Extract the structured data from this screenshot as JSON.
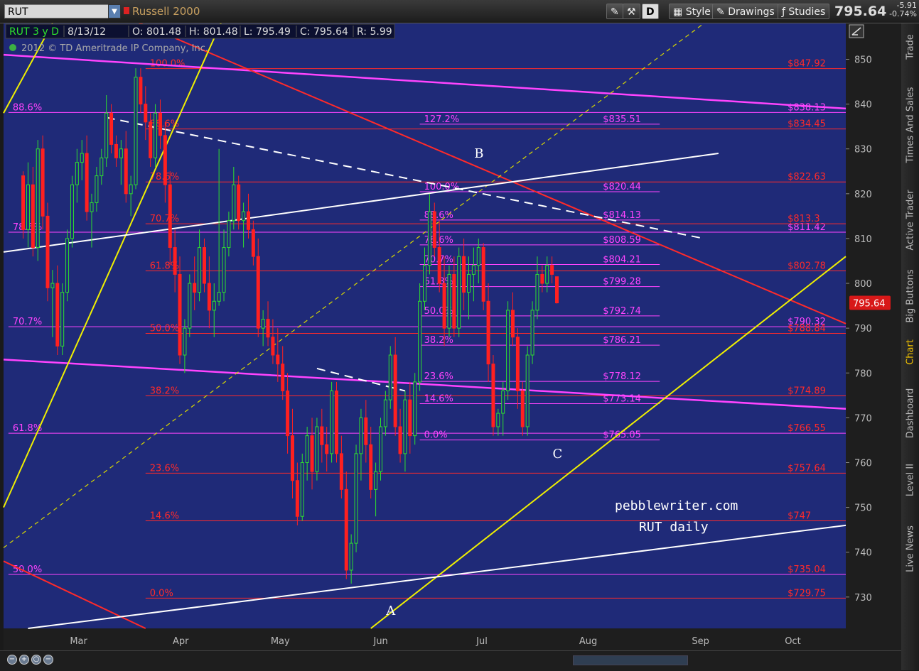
{
  "toolbar": {
    "symbol": "RUT",
    "symbol_name": "Russell 2000",
    "d_label": "D",
    "style_label": "Style",
    "drawings_label": "Drawings",
    "studies_label": "Studies",
    "last_price": "795.64",
    "change": "-5.91",
    "change_pct": "-0.74%"
  },
  "sidebar": {
    "tabs": [
      "Trade",
      "Times And Sales",
      "Active Trader",
      "Big Buttons",
      "Chart",
      "Dashboard",
      "Level II",
      "Live News"
    ],
    "active": "Chart"
  },
  "chart_data": {
    "type": "candlestick",
    "info_bar": {
      "title": "RUT 3 y D",
      "date": "8/13/12",
      "open": "O: 801.48",
      "high": "H: 801.48",
      "low": "L: 795.49",
      "close": "C: 795.64",
      "range": "R: 5.99"
    },
    "copyright": "2012 © TD Ameritrade IP Company, Inc.",
    "ylim": [
      723,
      858
    ],
    "y_ticks": [
      730,
      740,
      750,
      760,
      770,
      780,
      790,
      800,
      810,
      820,
      830,
      840,
      850
    ],
    "x_ticks": [
      {
        "label": "Mar",
        "x": 0
      },
      {
        "label": "Apr",
        "x": 21
      },
      {
        "label": "May",
        "x": 41
      },
      {
        "label": "Jun",
        "x": 62
      },
      {
        "label": "Jul",
        "x": 83
      },
      {
        "label": "Aug",
        "x": 104
      },
      {
        "label": "Sep",
        "x": 127
      },
      {
        "label": "Oct",
        "x": 146
      }
    ],
    "xlim": [
      -15,
      157
    ],
    "last_price_label": "795.64",
    "candles": [
      [
        -11,
        824,
        825,
        810,
        812
      ],
      [
        -10,
        812,
        827,
        808,
        822
      ],
      [
        -9,
        822,
        826,
        806,
        808
      ],
      [
        -8,
        808,
        832,
        805,
        830
      ],
      [
        -7,
        830,
        833,
        812,
        815
      ],
      [
        -6,
        815,
        818,
        796,
        799
      ],
      [
        -5,
        799,
        803,
        788,
        800
      ],
      [
        -4,
        800,
        804,
        784,
        786
      ],
      [
        -3,
        786,
        800,
        784,
        798
      ],
      [
        -2,
        798,
        812,
        796,
        810
      ],
      [
        -1,
        810,
        824,
        808,
        822
      ],
      [
        0,
        822,
        830,
        818,
        827
      ],
      [
        1,
        827,
        832,
        823,
        829
      ],
      [
        2,
        829,
        833,
        814,
        816
      ],
      [
        3,
        816,
        820,
        808,
        818
      ],
      [
        4,
        818,
        826,
        816,
        824
      ],
      [
        5,
        824,
        830,
        822,
        828
      ],
      [
        6,
        828,
        842,
        826,
        838
      ],
      [
        7,
        838,
        840,
        829,
        831
      ],
      [
        8,
        831,
        833,
        826,
        828
      ],
      [
        9,
        828,
        832,
        822,
        830
      ],
      [
        10,
        830,
        834,
        818,
        820
      ],
      [
        11,
        820,
        824,
        815,
        822
      ],
      [
        12,
        822,
        848,
        821,
        846
      ],
      [
        13,
        846,
        848,
        838,
        840
      ],
      [
        14,
        840,
        844,
        832,
        836
      ],
      [
        15,
        836,
        838,
        826,
        828
      ],
      [
        16,
        828,
        840,
        826,
        838
      ],
      [
        17,
        838,
        841,
        830,
        833
      ],
      [
        18,
        833,
        836,
        818,
        822
      ],
      [
        19,
        822,
        825,
        804,
        808
      ],
      [
        20,
        808,
        812,
        798,
        802
      ],
      [
        21,
        802,
        806,
        782,
        784
      ],
      [
        22,
        784,
        792,
        780,
        790
      ],
      [
        23,
        790,
        802,
        788,
        800
      ],
      [
        24,
        800,
        806,
        794,
        798
      ],
      [
        25,
        798,
        812,
        796,
        808
      ],
      [
        26,
        808,
        810,
        798,
        800
      ],
      [
        27,
        800,
        806,
        790,
        794
      ],
      [
        28,
        794,
        800,
        788,
        796
      ],
      [
        29,
        796,
        830,
        795,
        798
      ],
      [
        30,
        798,
        812,
        796,
        808
      ],
      [
        31,
        808,
        816,
        806,
        814
      ],
      [
        32,
        814,
        826,
        812,
        822
      ],
      [
        33,
        822,
        824,
        812,
        814
      ],
      [
        34,
        814,
        818,
        808,
        816
      ],
      [
        35,
        816,
        820,
        810,
        812
      ],
      [
        36,
        812,
        814,
        804,
        806
      ],
      [
        37,
        806,
        810,
        788,
        790
      ],
      [
        38,
        790,
        794,
        786,
        792
      ],
      [
        39,
        792,
        796,
        786,
        788
      ],
      [
        40,
        788,
        792,
        782,
        784
      ],
      [
        41,
        784,
        790,
        778,
        782
      ],
      [
        42,
        782,
        786,
        774,
        776
      ],
      [
        43,
        776,
        780,
        762,
        766
      ],
      [
        44,
        766,
        772,
        752,
        756
      ],
      [
        45,
        756,
        760,
        746,
        748
      ],
      [
        46,
        748,
        762,
        747,
        760
      ],
      [
        47,
        760,
        768,
        756,
        766
      ],
      [
        48,
        766,
        770,
        754,
        758
      ],
      [
        49,
        758,
        770,
        756,
        768
      ],
      [
        50,
        768,
        772,
        760,
        764
      ],
      [
        51,
        764,
        768,
        758,
        762
      ],
      [
        52,
        762,
        778,
        760,
        776
      ],
      [
        53,
        776,
        778,
        760,
        762
      ],
      [
        54,
        762,
        766,
        752,
        754
      ],
      [
        55,
        754,
        758,
        734,
        736
      ],
      [
        56,
        736,
        744,
        733,
        742
      ],
      [
        57,
        742,
        764,
        740,
        762
      ],
      [
        58,
        762,
        772,
        756,
        770
      ],
      [
        59,
        770,
        774,
        760,
        764
      ],
      [
        60,
        764,
        768,
        752,
        754
      ],
      [
        61,
        754,
        760,
        748,
        758
      ],
      [
        62,
        758,
        770,
        756,
        768
      ],
      [
        63,
        768,
        776,
        766,
        774
      ],
      [
        64,
        774,
        786,
        772,
        784
      ],
      [
        65,
        784,
        788,
        766,
        768
      ],
      [
        66,
        768,
        772,
        760,
        762
      ],
      [
        67,
        762,
        776,
        758,
        774
      ],
      [
        68,
        774,
        778,
        762,
        766
      ],
      [
        69,
        766,
        780,
        764,
        778
      ],
      [
        70,
        778,
        800,
        776,
        796
      ],
      [
        71,
        796,
        808,
        794,
        804
      ],
      [
        72,
        804,
        820,
        802,
        816
      ],
      [
        73,
        816,
        818,
        806,
        808
      ],
      [
        74,
        808,
        814,
        798,
        800
      ],
      [
        75,
        800,
        806,
        786,
        790
      ],
      [
        76,
        790,
        804,
        788,
        802
      ],
      [
        77,
        802,
        806,
        788,
        790
      ],
      [
        78,
        790,
        808,
        788,
        806
      ],
      [
        79,
        806,
        810,
        794,
        798
      ],
      [
        80,
        798,
        806,
        792,
        802
      ],
      [
        81,
        802,
        808,
        796,
        804
      ],
      [
        82,
        804,
        810,
        800,
        808
      ],
      [
        83,
        808,
        809,
        794,
        796
      ],
      [
        84,
        796,
        800,
        778,
        782
      ],
      [
        85,
        782,
        784,
        766,
        768
      ],
      [
        86,
        768,
        772,
        766,
        771
      ],
      [
        87,
        771,
        778,
        766,
        776
      ],
      [
        88,
        776,
        796,
        774,
        794
      ],
      [
        89,
        794,
        798,
        786,
        788
      ],
      [
        90,
        788,
        790,
        772,
        776
      ],
      [
        91,
        776,
        778,
        766,
        768
      ],
      [
        92,
        768,
        786,
        766,
        784
      ],
      [
        93,
        784,
        796,
        782,
        794
      ],
      [
        94,
        794,
        806,
        792,
        802
      ],
      [
        95,
        802,
        804,
        798,
        800
      ],
      [
        96,
        800,
        806,
        798,
        804
      ],
      [
        97,
        804,
        806,
        800,
        802
      ],
      [
        98,
        801.48,
        801.48,
        795.49,
        795.64
      ]
    ],
    "fib_sets": [
      {
        "name": "magenta-left",
        "color": "#ff44ff",
        "label_x": -14,
        "end_x": 157,
        "levels": [
          {
            "pct": "88.6%",
            "value": 838.13
          },
          {
            "pct": "78.6%",
            "value": 811.42
          },
          {
            "pct": "70.7%",
            "value": 790.32
          },
          {
            "pct": "61.8%",
            "value": 766.55
          },
          {
            "pct": "50.0%",
            "value": 735.04
          }
        ],
        "price_labels": [
          {
            "text": "$838.13",
            "value": 838.13
          },
          {
            "text": "$811.42",
            "value": 811.42
          },
          {
            "text": "$790.32",
            "value": 790.32
          }
        ]
      },
      {
        "name": "red-main",
        "color": "#ff2a2a",
        "label_x": 14,
        "end_x": 157,
        "levels": [
          {
            "pct": "100.0%",
            "value": 847.92
          },
          {
            "pct": "88.6%",
            "value": 834.45
          },
          {
            "pct": "78.6%",
            "value": 822.63
          },
          {
            "pct": "70.7%",
            "value": 813.3
          },
          {
            "pct": "61.8%",
            "value": 802.78
          },
          {
            "pct": "50.0%",
            "value": 788.84
          },
          {
            "pct": "38.2%",
            "value": 774.89
          },
          {
            "pct": "23.6%",
            "value": 757.64
          },
          {
            "pct": "14.6%",
            "value": 747
          },
          {
            "pct": "0.0%",
            "value": 729.75
          }
        ],
        "price_labels": [
          {
            "text": "$847.92",
            "value": 847.92
          },
          {
            "text": "$834.45",
            "value": 834.45
          },
          {
            "text": "$822.63",
            "value": 822.63
          },
          {
            "text": "$813.3",
            "value": 813.3
          },
          {
            "text": "$802.78",
            "value": 802.78
          },
          {
            "text": "$788.84",
            "value": 788.84
          },
          {
            "text": "$774.89",
            "value": 774.89
          },
          {
            "text": "$766.55",
            "value": 766.55
          },
          {
            "text": "$757.64",
            "value": 757.64
          },
          {
            "text": "$747",
            "value": 747
          },
          {
            "text": "$735.04",
            "value": 735.04
          },
          {
            "text": "$729.75",
            "value": 729.75
          }
        ]
      },
      {
        "name": "magenta-right",
        "color": "#ff44ff",
        "label_x": 70,
        "end_x": 119,
        "levels": [
          {
            "pct": "127.2%",
            "value": 835.51
          },
          {
            "pct": "100.0%",
            "value": 820.44
          },
          {
            "pct": "88.6%",
            "value": 814.13
          },
          {
            "pct": "78.6%",
            "value": 808.59
          },
          {
            "pct": "70.7%",
            "value": 804.21
          },
          {
            "pct": "61.8%",
            "value": 799.28
          },
          {
            "pct": "50.0%",
            "value": 792.74
          },
          {
            "pct": "38.2%",
            "value": 786.21
          },
          {
            "pct": "23.6%",
            "value": 778.12
          },
          {
            "pct": "14.6%",
            "value": 773.14
          },
          {
            "pct": "0.0%",
            "value": 765.05
          }
        ],
        "price_labels": [
          {
            "text": "$835.51",
            "value": 835.51
          },
          {
            "text": "$820.44",
            "value": 820.44
          },
          {
            "text": "$814.13",
            "value": 814.13
          },
          {
            "text": "$808.59",
            "value": 808.59
          },
          {
            "text": "$804.21",
            "value": 804.21
          },
          {
            "text": "$799.28",
            "value": 799.28
          },
          {
            "text": "$792.74",
            "value": 792.74
          },
          {
            "text": "$786.21",
            "value": 786.21
          },
          {
            "text": "$778.12",
            "value": 778.12
          },
          {
            "text": "$773.14",
            "value": 773.14
          },
          {
            "text": "$765.05",
            "value": 765.05
          }
        ]
      }
    ],
    "trendlines": [
      {
        "name": "magenta-upper-channel",
        "color": "#ff44ff",
        "width": 2.5,
        "x1": -15,
        "y1": 851,
        "x2": 157,
        "y2": 839
      },
      {
        "name": "magenta-lower-channel",
        "color": "#ff44ff",
        "width": 2.5,
        "x1": -15,
        "y1": 783,
        "x2": 157,
        "y2": 772
      },
      {
        "name": "red-upper-downtrend",
        "color": "#ff2a2a",
        "width": 2,
        "x1": -15,
        "y1": 871,
        "x2": 157,
        "y2": 791
      },
      {
        "name": "red-lower-downtrend",
        "color": "#ff2a2a",
        "width": 2,
        "x1": -15,
        "y1": 738,
        "x2": 14,
        "y2": 723
      },
      {
        "name": "yellow-left-uptrend",
        "color": "#f0f000",
        "width": 2,
        "x1": -15,
        "y1": 750,
        "x2": 31,
        "y2": 862
      },
      {
        "name": "yellow-left-uptrend-2",
        "color": "#f0f000",
        "width": 2,
        "x1": -15,
        "y1": 838,
        "x2": -5,
        "y2": 858
      },
      {
        "name": "yellow-right-uptrend",
        "color": "#f0f000",
        "width": 2,
        "x1": 60,
        "y1": 723,
        "x2": 157,
        "y2": 806
      },
      {
        "name": "yellow-dashed-midline",
        "color": "#d8d800",
        "width": 1.2,
        "dash": "6,5",
        "x1": -15,
        "y1": 741,
        "x2": 128,
        "y2": 858
      },
      {
        "name": "white-upper-trend",
        "color": "#ffffff",
        "width": 2,
        "x1": -15,
        "y1": 807,
        "x2": 131,
        "y2": 829
      },
      {
        "name": "white-lower-trend",
        "color": "#ffffff",
        "width": 2,
        "x1": -10,
        "y1": 723,
        "x2": 157,
        "y2": 746
      },
      {
        "name": "white-dashed-resistance",
        "color": "#ffffff",
        "width": 2,
        "dash": "12,8",
        "x1": 6,
        "y1": 837,
        "x2": 128,
        "y2": 810
      },
      {
        "name": "white-dashed-short",
        "color": "#ffffff",
        "width": 2,
        "dash": "12,8",
        "x1": 49,
        "y1": 781,
        "x2": 67,
        "y2": 776
      }
    ],
    "annotations": [
      {
        "text": "A",
        "x": 64,
        "y": 727
      },
      {
        "text": "B",
        "x": 82,
        "y": 829
      },
      {
        "text": "C",
        "x": 98,
        "y": 762
      }
    ],
    "watermark": [
      "pebblewriter.com",
      "RUT daily"
    ]
  }
}
